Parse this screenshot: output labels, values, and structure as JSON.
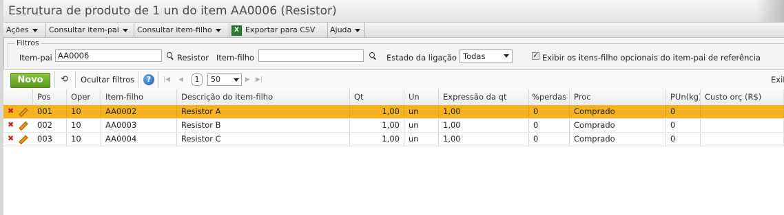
{
  "window": {
    "title": "Estrutura de produto de 1 un do item AA0006 (Resistor)"
  },
  "menu": {
    "acoes": "Ações",
    "consultar_pai": "Consultar item-pai",
    "consultar_filho": "Consultar item-filho",
    "exportar_csv": "Exportar para CSV",
    "ajuda": "Ajuda"
  },
  "filters": {
    "legend": "Filtros",
    "item_pai_label": "Item-pai",
    "item_pai_value": "AA0006",
    "item_pai_desc": "Resistor",
    "item_filho_label": "Item-filho",
    "item_filho_value": "",
    "estado_label": "Estado da ligação",
    "estado_value": "Todas",
    "exibir_label": "Exibir os itens-filho opcionais do item-pai de referência",
    "exibir_checked": true
  },
  "toolbar": {
    "novo": "Novo",
    "ocultar_filtros": "Ocultar filtros",
    "page": "1",
    "page_size": "50",
    "right_text": "Exil"
  },
  "grid": {
    "columns": [
      "Pos",
      "Oper",
      "Item-filho",
      "Descrição do item-filho",
      "Qt",
      "Un",
      "Expressão da qt",
      "%perdas",
      "Proc",
      "PUn(kg)",
      "Custo orç (R$)"
    ],
    "rows": [
      {
        "pos": "001",
        "oper": "10",
        "item": "AA0002",
        "desc": "Resistor A",
        "qt": "1,00",
        "un": "un",
        "expr": "1,00",
        "perdas": "0",
        "proc": "Comprado",
        "pun": "0",
        "custo": "",
        "selected": true
      },
      {
        "pos": "002",
        "oper": "10",
        "item": "AA0003",
        "desc": "Resistor B",
        "qt": "1,00",
        "un": "un",
        "expr": "1,00",
        "perdas": "0",
        "proc": "Comprado",
        "pun": "0",
        "custo": "",
        "selected": false
      },
      {
        "pos": "003",
        "oper": "10",
        "item": "AA0004",
        "desc": "Resistor C",
        "qt": "1,00",
        "un": "un",
        "expr": "1,00",
        "perdas": "0",
        "proc": "Comprado",
        "pun": "0",
        "custo": "",
        "selected": false
      }
    ]
  },
  "colors": {
    "accent_selected": "#f5b321",
    "novo_green": "#6aab27"
  }
}
